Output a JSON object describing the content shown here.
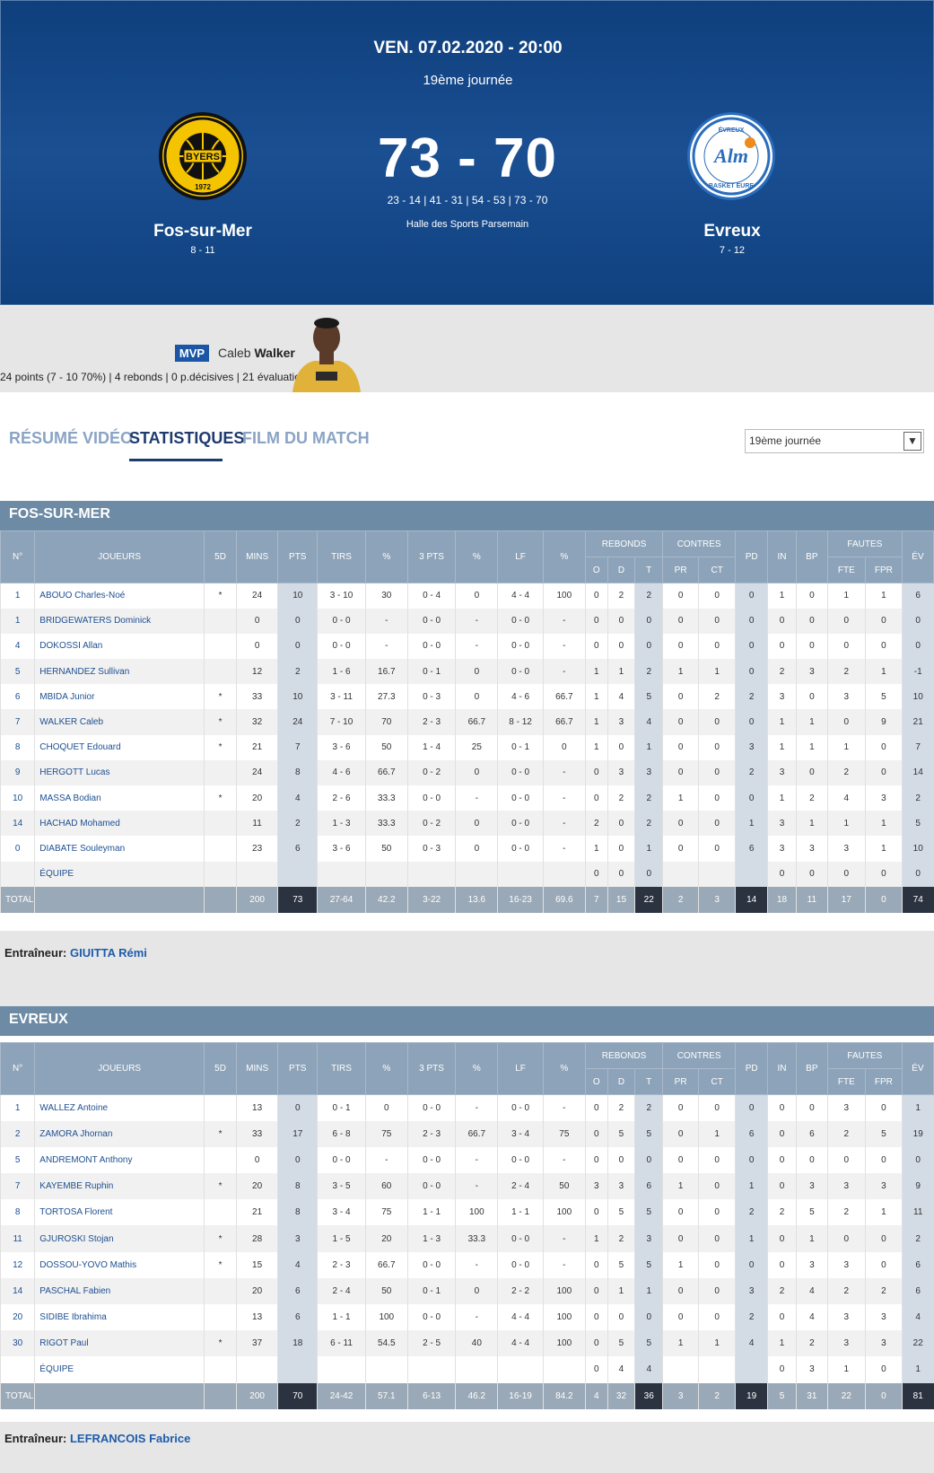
{
  "match": {
    "date": "VEN. 07.02.2020 - 20:00",
    "round": "19ème journée",
    "score": "73 - 70",
    "periods": "23 - 14 | 41 - 31 | 54 - 53 | 73 - 70",
    "venue": "Halle des Sports Parsemain",
    "home": {
      "name": "Fos-sur-Mer",
      "record": "8 - 11",
      "logo_text": "BYERS"
    },
    "away": {
      "name": "Evreux",
      "record": "7 - 12",
      "logo_text": "ALM"
    }
  },
  "mvp": {
    "badge": "MVP",
    "first": "Caleb",
    "last": "Walker",
    "stats": "24 points (7 - 10 70%) | 4 rebonds | 0 p.décisives | 21 évaluation"
  },
  "tabs": [
    "RÉSUMÉ VIDÉO",
    "STATISTIQUES",
    "FILM DU MATCH"
  ],
  "select_value": "19ème journée",
  "headers": {
    "no": "N°",
    "players": "JOUEURS",
    "five": "5D",
    "mins": "MINS",
    "pts": "PTS",
    "tirs": "TIRS",
    "pct": "%",
    "three": "3 PTS",
    "lf": "LF",
    "rebonds": "REBONDS",
    "o": "O",
    "d": "D",
    "t": "T",
    "contres": "CONTRES",
    "pr": "PR",
    "ct": "CT",
    "pd": "PD",
    "in": "IN",
    "bp": "BP",
    "fautes": "FAUTES",
    "fte": "FTE",
    "fpr": "FPR",
    "ev": "ÉV"
  },
  "teams": [
    {
      "title": "FOS-SUR-MER",
      "coach_label": "Entraîneur:",
      "coach": "GIUITTA Rémi",
      "rows": [
        [
          "1",
          "ABOUO Charles-Noé",
          "*",
          "24",
          "10",
          "3 - 10",
          "30",
          "0 - 4",
          "0",
          "4 - 4",
          "100",
          "0",
          "2",
          "2",
          "0",
          "0",
          "0",
          "1",
          "0",
          "1",
          "1",
          "6"
        ],
        [
          "1",
          "BRIDGEWATERS Dominick",
          "",
          "0",
          "0",
          "0 - 0",
          "-",
          "0 - 0",
          "-",
          "0 - 0",
          "-",
          "0",
          "0",
          "0",
          "0",
          "0",
          "0",
          "0",
          "0",
          "0",
          "0",
          "0"
        ],
        [
          "4",
          "DOKOSSI Allan",
          "",
          "0",
          "0",
          "0 - 0",
          "-",
          "0 - 0",
          "-",
          "0 - 0",
          "-",
          "0",
          "0",
          "0",
          "0",
          "0",
          "0",
          "0",
          "0",
          "0",
          "0",
          "0"
        ],
        [
          "5",
          "HERNANDEZ Sullivan",
          "",
          "12",
          "2",
          "1 - 6",
          "16.7",
          "0 - 1",
          "0",
          "0 - 0",
          "-",
          "1",
          "1",
          "2",
          "1",
          "1",
          "0",
          "2",
          "3",
          "2",
          "1",
          "-1"
        ],
        [
          "6",
          "MBIDA Junior",
          "*",
          "33",
          "10",
          "3 - 11",
          "27.3",
          "0 - 3",
          "0",
          "4 - 6",
          "66.7",
          "1",
          "4",
          "5",
          "0",
          "2",
          "2",
          "3",
          "0",
          "3",
          "5",
          "10"
        ],
        [
          "7",
          "WALKER Caleb",
          "*",
          "32",
          "24",
          "7 - 10",
          "70",
          "2 - 3",
          "66.7",
          "8 - 12",
          "66.7",
          "1",
          "3",
          "4",
          "0",
          "0",
          "0",
          "1",
          "1",
          "0",
          "9",
          "21"
        ],
        [
          "8",
          "CHOQUET Edouard",
          "*",
          "21",
          "7",
          "3 - 6",
          "50",
          "1 - 4",
          "25",
          "0 - 1",
          "0",
          "1",
          "0",
          "1",
          "0",
          "0",
          "3",
          "1",
          "1",
          "1",
          "0",
          "7"
        ],
        [
          "9",
          "HERGOTT Lucas",
          "",
          "24",
          "8",
          "4 - 6",
          "66.7",
          "0 - 2",
          "0",
          "0 - 0",
          "-",
          "0",
          "3",
          "3",
          "0",
          "0",
          "2",
          "3",
          "0",
          "2",
          "0",
          "14"
        ],
        [
          "10",
          "MASSA Bodian",
          "*",
          "20",
          "4",
          "2 - 6",
          "33.3",
          "0 - 0",
          "-",
          "0 - 0",
          "-",
          "0",
          "2",
          "2",
          "1",
          "0",
          "0",
          "1",
          "2",
          "4",
          "3",
          "2"
        ],
        [
          "14",
          "HACHAD Mohamed",
          "",
          "11",
          "2",
          "1 - 3",
          "33.3",
          "0 - 2",
          "0",
          "0 - 0",
          "-",
          "2",
          "0",
          "2",
          "0",
          "0",
          "1",
          "3",
          "1",
          "1",
          "1",
          "5"
        ],
        [
          "0",
          "DIABATE Souleyman",
          "",
          "23",
          "6",
          "3 - 6",
          "50",
          "0 - 3",
          "0",
          "0 - 0",
          "-",
          "1",
          "0",
          "1",
          "0",
          "0",
          "6",
          "3",
          "3",
          "3",
          "1",
          "10"
        ],
        [
          "",
          "ÉQUIPE",
          "",
          "",
          "",
          "",
          "",
          "",
          "",
          "",
          "",
          "0",
          "0",
          "0",
          "",
          "",
          "",
          "0",
          "0",
          "0",
          "0",
          "0"
        ]
      ],
      "total": [
        "TOTAL",
        "",
        "",
        "200",
        "73",
        "27-64",
        "42.2",
        "3-22",
        "13.6",
        "16-23",
        "69.6",
        "7",
        "15",
        "22",
        "2",
        "3",
        "14",
        "18",
        "11",
        "17",
        "0",
        "74"
      ]
    },
    {
      "title": "EVREUX",
      "coach_label": "Entraîneur:",
      "coach": "LEFRANCOIS Fabrice",
      "rows": [
        [
          "1",
          "WALLEZ Antoine",
          "",
          "13",
          "0",
          "0 - 1",
          "0",
          "0 - 0",
          "-",
          "0 - 0",
          "-",
          "0",
          "2",
          "2",
          "0",
          "0",
          "0",
          "0",
          "0",
          "3",
          "0",
          "1"
        ],
        [
          "2",
          "ZAMORA Jhornan",
          "*",
          "33",
          "17",
          "6 - 8",
          "75",
          "2 - 3",
          "66.7",
          "3 - 4",
          "75",
          "0",
          "5",
          "5",
          "0",
          "1",
          "6",
          "0",
          "6",
          "2",
          "5",
          "19"
        ],
        [
          "5",
          "ANDREMONT Anthony",
          "",
          "0",
          "0",
          "0 - 0",
          "-",
          "0 - 0",
          "-",
          "0 - 0",
          "-",
          "0",
          "0",
          "0",
          "0",
          "0",
          "0",
          "0",
          "0",
          "0",
          "0",
          "0"
        ],
        [
          "7",
          "KAYEMBE Ruphin",
          "*",
          "20",
          "8",
          "3 - 5",
          "60",
          "0 - 0",
          "-",
          "2 - 4",
          "50",
          "3",
          "3",
          "6",
          "1",
          "0",
          "1",
          "0",
          "3",
          "3",
          "3",
          "9"
        ],
        [
          "8",
          "TORTOSA Florent",
          "",
          "21",
          "8",
          "3 - 4",
          "75",
          "1 - 1",
          "100",
          "1 - 1",
          "100",
          "0",
          "5",
          "5",
          "0",
          "0",
          "2",
          "2",
          "5",
          "2",
          "1",
          "11"
        ],
        [
          "11",
          "GJUROSKI Stojan",
          "*",
          "28",
          "3",
          "1 - 5",
          "20",
          "1 - 3",
          "33.3",
          "0 - 0",
          "-",
          "1",
          "2",
          "3",
          "0",
          "0",
          "1",
          "0",
          "1",
          "0",
          "0",
          "2"
        ],
        [
          "12",
          "DOSSOU-YOVO Mathis",
          "*",
          "15",
          "4",
          "2 - 3",
          "66.7",
          "0 - 0",
          "-",
          "0 - 0",
          "-",
          "0",
          "5",
          "5",
          "1",
          "0",
          "0",
          "0",
          "3",
          "3",
          "0",
          "6"
        ],
        [
          "14",
          "PASCHAL Fabien",
          "",
          "20",
          "6",
          "2 - 4",
          "50",
          "0 - 1",
          "0",
          "2 - 2",
          "100",
          "0",
          "1",
          "1",
          "0",
          "0",
          "3",
          "2",
          "4",
          "2",
          "2",
          "6"
        ],
        [
          "20",
          "SIDIBE Ibrahima",
          "",
          "13",
          "6",
          "1 - 1",
          "100",
          "0 - 0",
          "-",
          "4 - 4",
          "100",
          "0",
          "0",
          "0",
          "0",
          "0",
          "2",
          "0",
          "4",
          "3",
          "3",
          "4"
        ],
        [
          "30",
          "RIGOT Paul",
          "*",
          "37",
          "18",
          "6 - 11",
          "54.5",
          "2 - 5",
          "40",
          "4 - 4",
          "100",
          "0",
          "5",
          "5",
          "1",
          "1",
          "4",
          "1",
          "2",
          "3",
          "3",
          "22"
        ],
        [
          "",
          "ÉQUIPE",
          "",
          "",
          "",
          "",
          "",
          "",
          "",
          "",
          "",
          "0",
          "4",
          "4",
          "",
          "",
          "",
          "0",
          "3",
          "1",
          "0",
          "1"
        ]
      ],
      "total": [
        "TOTAL",
        "",
        "",
        "200",
        "70",
        "24-42",
        "57.1",
        "6-13",
        "46.2",
        "16-19",
        "84.2",
        "4",
        "32",
        "36",
        "3",
        "2",
        "19",
        "5",
        "31",
        "22",
        "0",
        "81"
      ]
    }
  ],
  "colors": {
    "header_bg": "#14467f",
    "table_head": "#8da3b9",
    "team_band": "#6d8ba5",
    "link": "#1e4f91"
  }
}
